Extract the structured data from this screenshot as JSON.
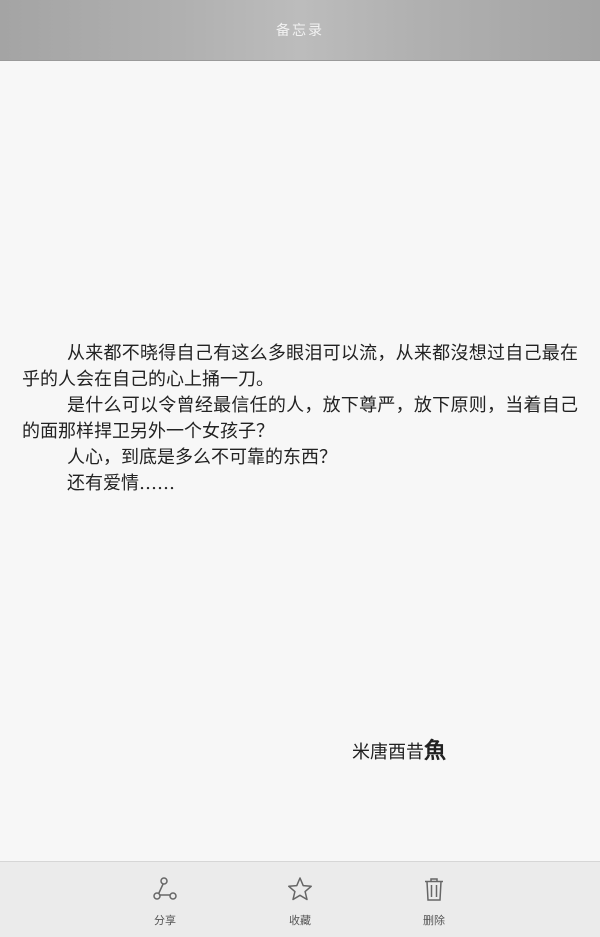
{
  "header": {
    "title": "备忘录"
  },
  "memo": {
    "paragraphs": [
      "从来都不晓得自己有这么多眼泪可以流，从来都沒想过自己最在乎的人会在自己的心上捅一刀。",
      "是什么可以令曾经最信任的人，放下尊严，放下原则，当着自己的面那样捍卫另外一个女孩子？",
      "人心，到底是多么不可靠的东西？",
      "还有爱情……"
    ],
    "signature": "米唐酉昔",
    "signature_char": "魚"
  },
  "toolbar": {
    "share_label": "分享",
    "favorite_label": "收藏",
    "delete_label": "删除"
  },
  "colors": {
    "header_bg": "#b0b0b0",
    "content_bg": "#f7f7f7",
    "toolbar_bg": "#ebebeb",
    "icon": "#666666"
  }
}
